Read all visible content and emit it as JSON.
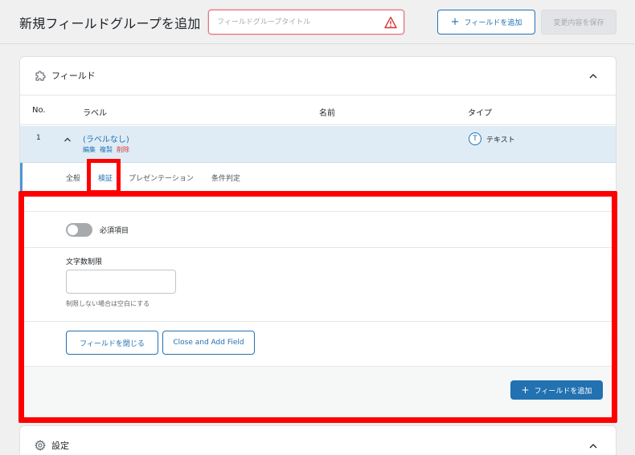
{
  "header": {
    "title": "新規フィールドグループを追加",
    "title_input_placeholder": "フィールドグループタイトル",
    "add_field_label": "フィールドを追加",
    "save_label": "変更内容を保存"
  },
  "fields_panel": {
    "title": "フィールド",
    "columns": {
      "no": "No.",
      "label": "ラベル",
      "name": "名前",
      "type": "タイプ"
    },
    "row": {
      "number": "1",
      "label": "(ラベルなし)",
      "actions": {
        "edit": "編集",
        "duplicate": "複製",
        "delete": "削除"
      },
      "type_glyph": "T",
      "type": "テキスト"
    },
    "tabs": [
      {
        "label": "全般"
      },
      {
        "label": "検証"
      },
      {
        "label": "プレゼンテーション"
      },
      {
        "label": "条件判定"
      }
    ],
    "active_tab": 1,
    "validation": {
      "required_label": "必須項目",
      "required_on": false,
      "char_limit_label": "文字数制限",
      "char_limit_value": "",
      "char_limit_help": "制限しない場合は空白にする"
    },
    "buttons": {
      "close_field": "フィールドを閉じる",
      "close_and_add": "Close and Add Field",
      "add_field": "フィールドを追加"
    }
  },
  "settings_panel": {
    "title": "設定"
  },
  "icons": {
    "warning": "warning-icon",
    "plus": "plus-icon",
    "puzzle": "puzzle-icon",
    "chevron": "chevron-up-icon",
    "gear": "gear-icon",
    "text_type": "text-type-icon"
  },
  "colors": {
    "accent": "#2271b1",
    "danger": "#d63638",
    "highlight": "#ff0000",
    "row_selected": "#dfecf5"
  }
}
